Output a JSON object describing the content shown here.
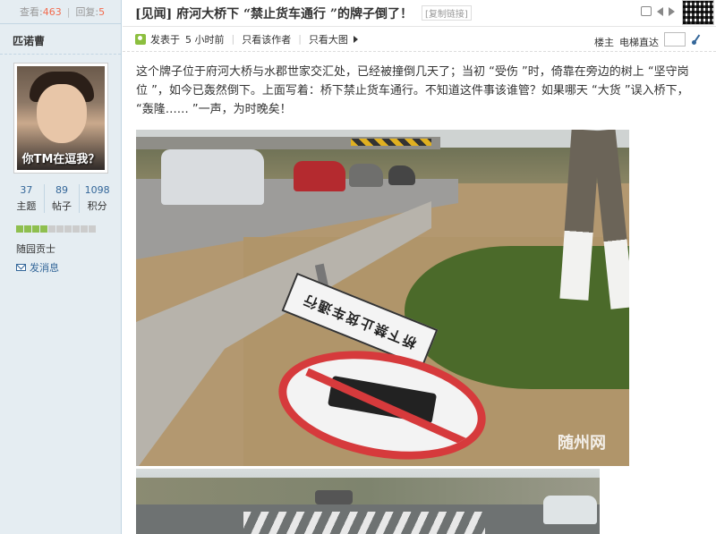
{
  "sidebar": {
    "views_label": "查看:",
    "views": "463",
    "replies_label": "回复:",
    "replies": "5",
    "author": "匹诺曹",
    "avatar_caption": "你TM在逗我？",
    "counts": [
      {
        "num": "37",
        "label": "主题"
      },
      {
        "num": "89",
        "label": "帖子"
      },
      {
        "num": "1098",
        "label": "积分"
      }
    ],
    "usergroup": "随园贡士",
    "send_message": "发消息"
  },
  "thread": {
    "title": "[见闻] 府河大桥下 “禁止货车通行 ”的牌子倒了！",
    "copy_link": "[复制链接]"
  },
  "meta": {
    "posted_label": "发表于",
    "posted_time": "5 小时前",
    "only_author": "只看该作者",
    "big_image": "只看大图",
    "floor": "楼主",
    "elevator": "电梯直达"
  },
  "post": {
    "text": "这个牌子位于府河大桥与水郡世家交汇处，已经被撞倒几天了；当初 “受伤 ”时，倚靠在旁边的树上 “坚守岗位 ”，如今已轰然倒下。上面写着：桥下禁止货车通行。不知道这件事该谁管？如果哪天 “大货 ”误入桥下， “轰隆…… ”一声，为时晚矣！"
  },
  "photo1": {
    "sign_text": "桥下禁止货车通行",
    "watermark": "随州网"
  }
}
